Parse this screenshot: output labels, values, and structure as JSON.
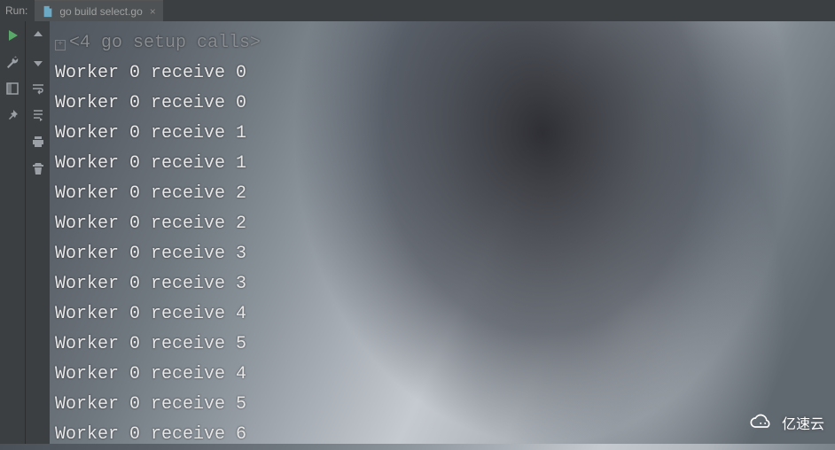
{
  "topbar": {
    "run_label": "Run:",
    "tab_title": "go build select.go",
    "tab_close": "×"
  },
  "console": {
    "setup_line": "<4 go setup calls>",
    "lines": [
      "Worker 0 receive 0",
      "Worker 0 receive 0",
      "Worker 0 receive 1",
      "Worker 0 receive 1",
      "Worker 0 receive 2",
      "Worker 0 receive 2",
      "Worker 0 receive 3",
      "Worker 0 receive 3",
      "Worker 0 receive 4",
      "Worker 0 receive 5",
      "Worker 0 receive 4",
      "Worker 0 receive 5",
      "Worker 0 receive 6"
    ]
  },
  "watermark": {
    "text": "亿速云"
  },
  "icons": {
    "expand": "+"
  }
}
